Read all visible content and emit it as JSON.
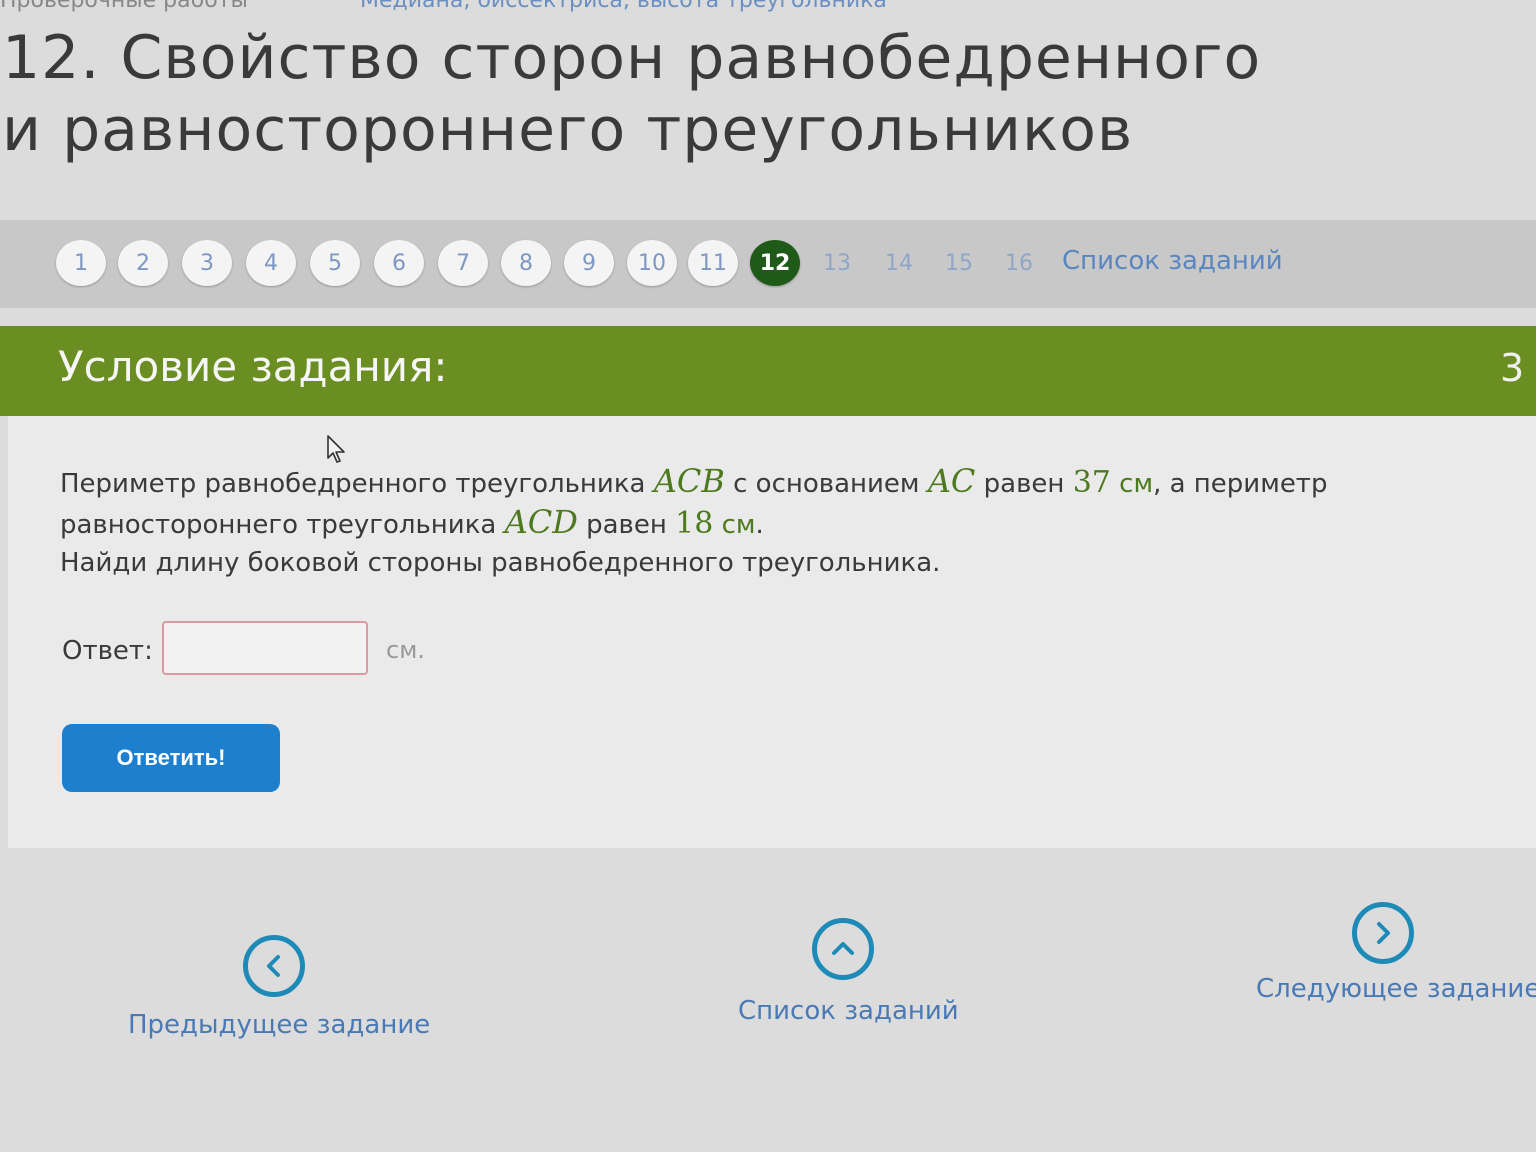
{
  "breadcrumb": {
    "parent": "Проверочные работы",
    "current": "Медиана, биссектриса, высота треугольника"
  },
  "page_title": "12. Свойство сторон равнобедренного и равностороннего треугольников",
  "task_nav": {
    "numbers": [
      "1",
      "2",
      "3",
      "4",
      "5",
      "6",
      "7",
      "8",
      "9",
      "10",
      "11",
      "12",
      "13",
      "14",
      "15",
      "16"
    ],
    "active": "12",
    "list_link": "Список заданий"
  },
  "condition": {
    "title": "Условие задания:",
    "points": "3"
  },
  "problem": {
    "p1": "Периметр равнобедренного треугольника ",
    "tri1": "ACB",
    "p2": " с основанием ",
    "base": "AC",
    "p3": " равен ",
    "perim1": "37",
    "unit1": " см",
    "p4": ", а периметр равностороннего треугольника ",
    "tri2": "ACD",
    "p5": " равен ",
    "perim2": "18",
    "unit2": " см",
    "p6": ".",
    "question": "Найди длину боковой стороны равнобедренного треугольника."
  },
  "answer": {
    "label": "Ответ:",
    "value": "",
    "unit": "см."
  },
  "submit_label": "Ответить!",
  "bottom_nav": {
    "prev_label": "Предыдущее задание",
    "list_label": "Список заданий",
    "next_label": "Следующее задание"
  },
  "icons": [
    "cursor-icon",
    "chevron-left-icon",
    "chevron-up-icon",
    "chevron-right-icon"
  ],
  "colors": {
    "accent_green": "#6b8e23",
    "active_number": "#1f5a18",
    "button_blue": "#1f7fcf",
    "link_blue": "#4a7ab5"
  }
}
